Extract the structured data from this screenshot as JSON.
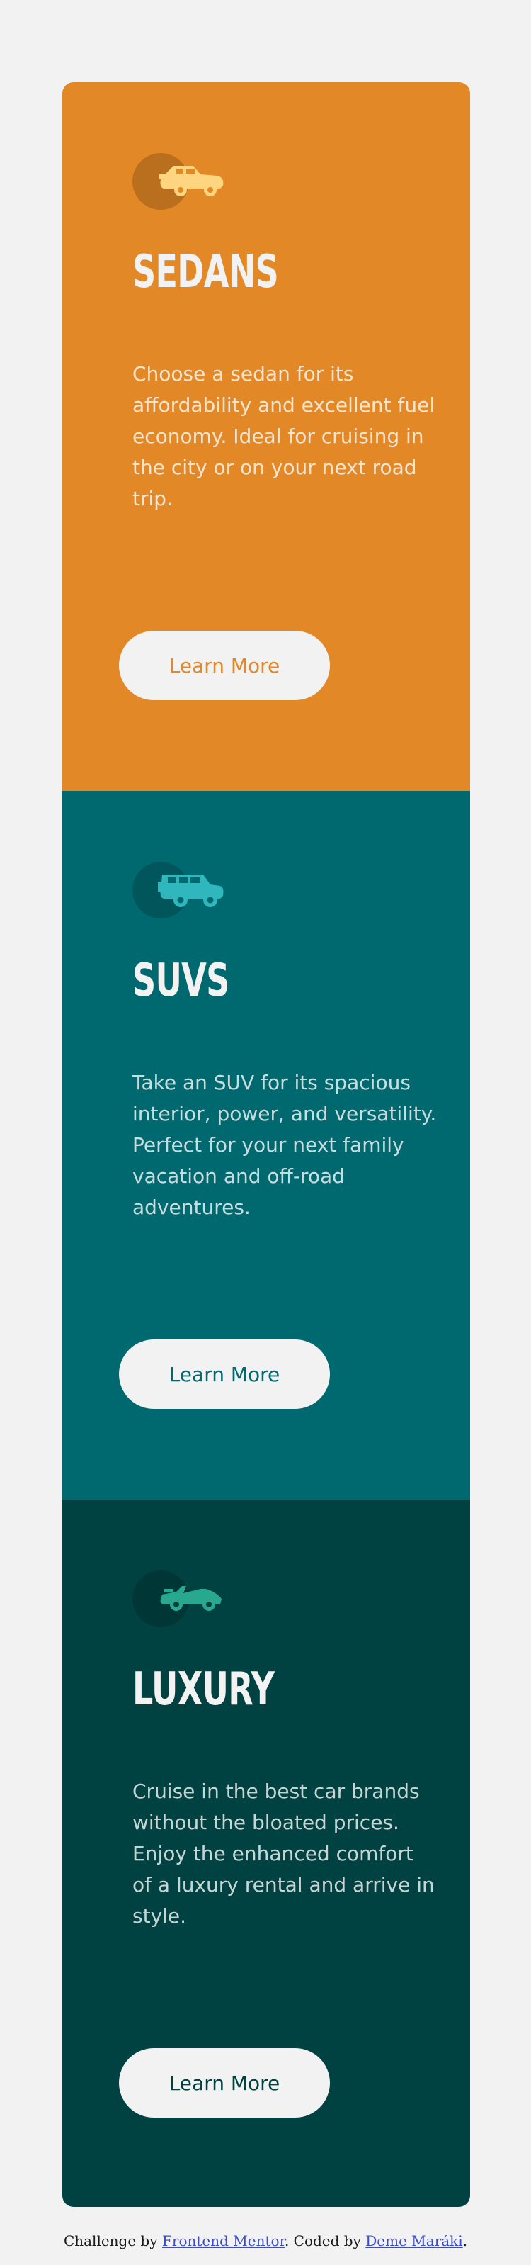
{
  "cards": [
    {
      "icon": "sedan-car-icon",
      "title": "SEDANS",
      "text": "Choose a sedan for its affordability and excellent fuel economy. Ideal for cruising in the city or on your next road trip.",
      "button_label": "Learn More",
      "background": "#e38826",
      "icon_color": "#ffd580"
    },
    {
      "icon": "suv-car-icon",
      "title": "SUVS",
      "text": "Take an SUV for its spacious interior, power, and versatility. Perfect for your next family vacation and off-road adventures.",
      "button_label": "Learn More",
      "background": "#006970",
      "icon_color": "#2fb7bd"
    },
    {
      "icon": "luxury-car-icon",
      "title": "LUXURY",
      "text": "Cruise in the best car brands without the bloated prices. Enjoy the enhanced comfort of a luxury rental and arrive in style.",
      "button_label": "Learn More",
      "background": "#004241",
      "icon_color": "#28a98f"
    }
  ],
  "attribution": {
    "prefix": "Challenge by ",
    "challenge_link": "Frontend Mentor",
    "middle": ". Coded by ",
    "author_link": "Deme Maráki",
    "suffix": "."
  }
}
